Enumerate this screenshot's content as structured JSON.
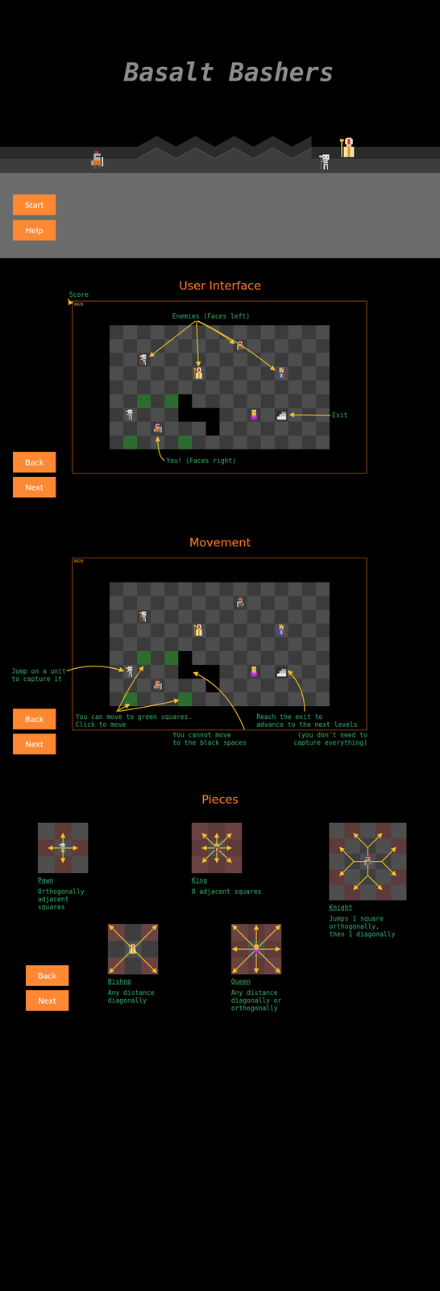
{
  "game": {
    "title": "Basalt Bashers"
  },
  "menu": {
    "buttons": [
      "Start",
      "Help"
    ]
  },
  "hero": {
    "units": [
      {
        "kind": "player",
        "facing": "right"
      },
      {
        "kind": "pawn",
        "facing": "left"
      },
      {
        "kind": "bishop",
        "facing": "left"
      }
    ]
  },
  "board": {
    "score": "0020",
    "units": [
      {
        "kind": "pawn",
        "facing": "left",
        "col": 2,
        "row": 2
      },
      {
        "kind": "knight",
        "facing": "left",
        "col": 9,
        "row": 1
      },
      {
        "kind": "bishop",
        "facing": "left",
        "col": 6,
        "row": 3
      },
      {
        "kind": "king",
        "facing": "left",
        "col": 12,
        "row": 3
      },
      {
        "kind": "queen",
        "facing": "left",
        "col": 10,
        "row": 6
      },
      {
        "kind": "pawn",
        "facing": "left",
        "col": 1,
        "row": 6
      },
      {
        "kind": "player",
        "facing": "right",
        "col": 3,
        "row": 7
      },
      {
        "kind": "exit",
        "facing": "right",
        "col": 12,
        "row": 6
      }
    ],
    "moves": [
      [
        2,
        5
      ],
      [
        4,
        5
      ],
      [
        1,
        8
      ],
      [
        5,
        8
      ]
    ],
    "walls": [
      [
        5,
        5
      ],
      [
        5,
        6
      ],
      [
        6,
        6
      ],
      [
        7,
        6
      ],
      [
        7,
        7
      ]
    ]
  },
  "sections": [
    {
      "kind": "interface",
      "heading": "User Interface",
      "annotations": [
        {
          "lines": [
            "Score"
          ]
        },
        {
          "lines": [
            "Enemies (Faces left)"
          ]
        },
        {
          "lines": [
            "Exit"
          ]
        },
        {
          "lines": [
            "You! (Faces right)"
          ]
        }
      ],
      "nav": [
        "Back",
        "Next"
      ]
    },
    {
      "kind": "movement",
      "heading": "Movement",
      "annotations": [
        {
          "lines": [
            "Jump on a unit",
            "to capture it"
          ]
        },
        {
          "lines": [
            "You can move to green squares.",
            "Click to move"
          ]
        },
        {
          "lines": [
            "You cannot move",
            "to the black spaces"
          ]
        },
        {
          "lines": [
            "Reach the exit to",
            "advance to the next levels"
          ]
        },
        {
          "lines": [
            "(you don't need to",
            "capture everything)"
          ]
        }
      ],
      "nav": [
        "Back",
        "Next"
      ]
    }
  ],
  "pieces": {
    "heading": "Pieces",
    "items": [
      {
        "name": "Pawn",
        "kind": "pawn",
        "description": [
          "Orthogonally",
          "adjacent",
          "squares"
        ],
        "slides": false,
        "targets": [
          [
            0,
            -1
          ],
          [
            1,
            0
          ],
          [
            0,
            1
          ],
          [
            -1,
            0
          ]
        ]
      },
      {
        "name": "King",
        "kind": "king",
        "description": [
          "8 adjacent squares"
        ],
        "slides": false,
        "targets": [
          [
            0,
            -1
          ],
          [
            1,
            -1
          ],
          [
            1,
            0
          ],
          [
            1,
            1
          ],
          [
            0,
            1
          ],
          [
            -1,
            1
          ],
          [
            -1,
            0
          ],
          [
            -1,
            -1
          ]
        ]
      },
      {
        "name": "Knight",
        "kind": "knight",
        "description": [
          "Jumps 1 square",
          "orthogonally,",
          "then 1 diagonally"
        ],
        "slides": false,
        "targets": [
          [
            1,
            -2
          ],
          [
            2,
            -1
          ],
          [
            2,
            1
          ],
          [
            1,
            2
          ],
          [
            -1,
            2
          ],
          [
            -2,
            1
          ],
          [
            -2,
            -1
          ],
          [
            -1,
            -2
          ]
        ]
      },
      {
        "name": "Bishop",
        "kind": "bishop",
        "description": [
          "Any distance",
          "diagonally"
        ],
        "slides": true,
        "targets": [
          [
            1,
            -1
          ],
          [
            1,
            1
          ],
          [
            -1,
            1
          ],
          [
            -1,
            -1
          ]
        ]
      },
      {
        "name": "Queen",
        "kind": "queen",
        "description": [
          "Any distance",
          "diagonally or",
          "orthogonally"
        ],
        "slides": true,
        "targets": [
          [
            0,
            -1
          ],
          [
            1,
            -1
          ],
          [
            1,
            0
          ],
          [
            1,
            1
          ],
          [
            0,
            1
          ],
          [
            -1,
            1
          ],
          [
            -1,
            0
          ],
          [
            -1,
            -1
          ]
        ]
      }
    ],
    "nav": [
      "Back",
      "Next"
    ]
  }
}
